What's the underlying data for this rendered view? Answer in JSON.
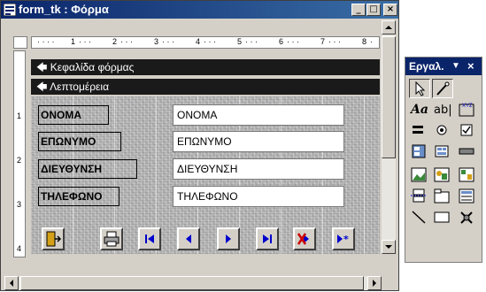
{
  "window": {
    "title": "form_tk : Φόρμα",
    "minimize": "_",
    "maximize": "□",
    "close": "×"
  },
  "ruler": {
    "ticks": [
      "1",
      "2",
      "3",
      "4",
      "5",
      "6",
      "7",
      "8"
    ]
  },
  "vruler": {
    "ticks": [
      "1",
      "2",
      "3",
      "4"
    ]
  },
  "sections": {
    "header": "Κεφαλίδα φόρμας",
    "detail": "Λεπτομέρεια"
  },
  "fields": [
    {
      "label": "ΟΝΟΜΑ",
      "value": "ΟΝΟΜΑ"
    },
    {
      "label": "ΕΠΩΝΥΜΟ",
      "value": "ΕΠΩΝΥΜΟ"
    },
    {
      "label": "ΔΙΕΥΘΥΝΣΗ",
      "value": "ΔΙΕΥΘΥΝΣΗ"
    },
    {
      "label": "ΤΗΛΕΦΩΝΟ",
      "value": "ΤΗΛΕΦΩΝΟ"
    }
  ],
  "nav_buttons": [
    "exit-icon",
    "print-icon",
    "first-record-icon",
    "previous-record-icon",
    "next-record-icon",
    "last-record-icon",
    "delete-record-icon",
    "new-record-icon"
  ],
  "toolbox": {
    "title": "Εργαλ.",
    "tools": [
      "select-objects-icon",
      "control-wizards-icon",
      "label-icon",
      "textbox-icon",
      "option-group-icon",
      "toggle-button-icon",
      "option-button-icon",
      "checkbox-icon",
      "combo-box-icon",
      "list-box-icon",
      "command-button-icon",
      "image-icon",
      "unbound-object-frame-icon",
      "bound-object-frame-icon",
      "page-break-icon",
      "tab-control-icon",
      "subform-icon",
      "line-icon",
      "rectangle-icon",
      "more-controls-icon"
    ]
  },
  "colors": {
    "title_bar": "#0a246a",
    "section_bar": "#1a1a1a",
    "nav_icon_blue": "#0000cc",
    "delete_red": "#cc0000"
  }
}
